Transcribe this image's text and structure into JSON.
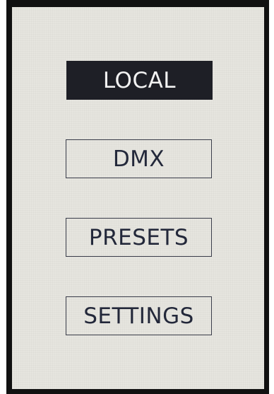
{
  "menu": {
    "items": [
      {
        "label": "LOCAL",
        "selected": true
      },
      {
        "label": "DMX",
        "selected": false
      },
      {
        "label": "PRESETS",
        "selected": false
      },
      {
        "label": "SETTINGS",
        "selected": false
      }
    ]
  },
  "colors": {
    "screen_background": "#e6e5df",
    "selected_background": "#1e1f26",
    "selected_text": "#f2f2f2",
    "text": "#23283a",
    "border": "#3a3d4a",
    "bezel": "#111111"
  }
}
